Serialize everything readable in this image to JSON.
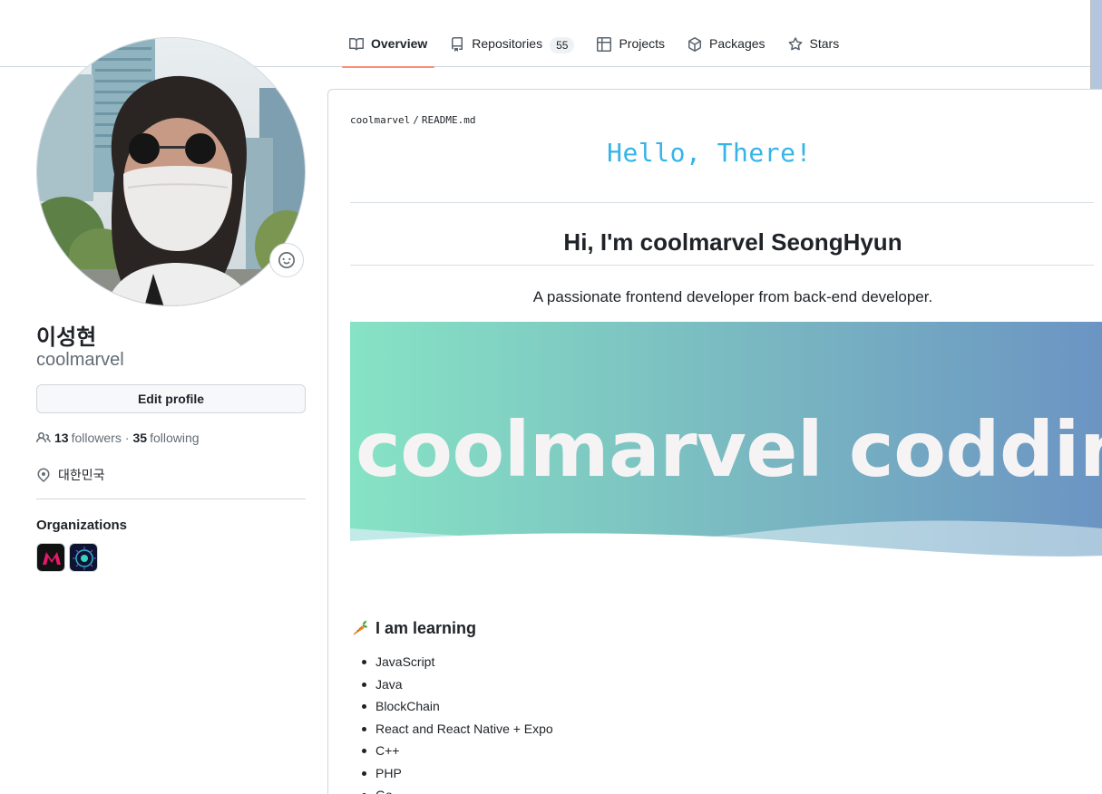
{
  "tabs": [
    {
      "label": "Overview",
      "icon": "book-icon",
      "active": true
    },
    {
      "label": "Repositories",
      "icon": "repo-icon",
      "count": "55"
    },
    {
      "label": "Projects",
      "icon": "table-icon"
    },
    {
      "label": "Packages",
      "icon": "package-icon"
    },
    {
      "label": "Stars",
      "icon": "star-icon"
    }
  ],
  "profile": {
    "full_name": "이성현",
    "login": "coolmarvel",
    "edit_label": "Edit profile",
    "followers_count": "13",
    "followers_label": "followers",
    "separator": "·",
    "following_count": "35",
    "following_label": "following",
    "location": "대한민국"
  },
  "organizations": {
    "title": "Organizations"
  },
  "readme": {
    "path_user": "coolmarvel",
    "path_sep": "/",
    "path_file": "README.md",
    "hello": "Hello, There!",
    "heading": "Hi, I'm coolmarvel SeongHyun",
    "tagline": "A passionate frontend developer from back-end developer.",
    "banner_text": "coolmarvel codding",
    "learning_title": "I am learning",
    "learning": [
      "JavaScript",
      "Java",
      "BlockChain",
      "React and React Native + Expo",
      "C++",
      "PHP",
      "Go"
    ]
  },
  "colors": {
    "accent_underline": "#fd8c73",
    "hello_text": "#36b4e8",
    "banner_gradient_start": "#86e3c4",
    "banner_gradient_end": "#6b94c3"
  }
}
